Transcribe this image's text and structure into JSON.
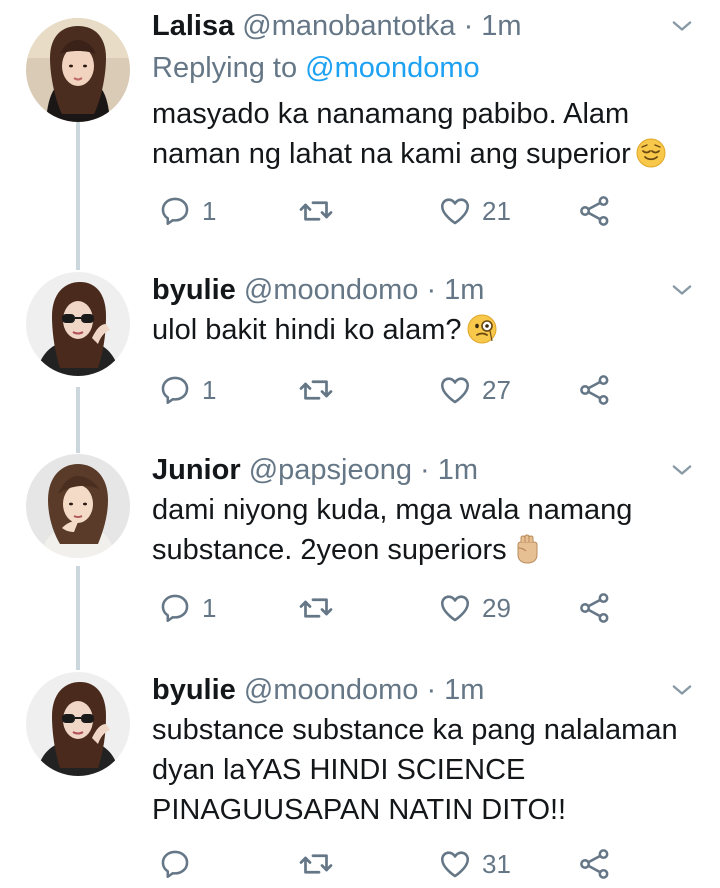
{
  "tweets": [
    {
      "name": "Lalisa",
      "handle": "@manobantotka",
      "time": "· 1m",
      "replying_prefix": "Replying to ",
      "replying_handle": "@moondomo",
      "text": "masyado ka nanamang pabibo. Alam naman ng lahat na kami ang superior",
      "emoji": "relieved-face",
      "replies": "1",
      "retweets": "",
      "likes": "21"
    },
    {
      "name": "byulie",
      "handle": "@moondomo",
      "time": "· 1m",
      "text": "ulol bakit hindi ko alam?",
      "emoji": "face-with-monocle",
      "replies": "1",
      "retweets": "",
      "likes": "27"
    },
    {
      "name": "Junior",
      "handle": "@papsjeong",
      "time": "· 1m",
      "text": "dami niyong kuda, mga wala namang substance. 2yeon superiors",
      "emoji": "raised-fist-medium-light",
      "replies": "1",
      "retweets": "",
      "likes": "29"
    },
    {
      "name": "byulie",
      "handle": "@moondomo",
      "time": "· 1m",
      "text": "substance substance ka pang nalalaman dyan laYAS HINDI SCIENCE PINAGUUSAPAN NATIN DITO!!",
      "replies": "",
      "retweets": "",
      "likes": "31"
    }
  ],
  "colors": {
    "text": "#14171a",
    "muted": "#657786",
    "link": "#1da1f2",
    "thread_line": "#ccd6dd"
  },
  "icons": [
    "reply-icon",
    "retweet-icon",
    "like-icon",
    "share-icon",
    "chevron-down-icon"
  ]
}
